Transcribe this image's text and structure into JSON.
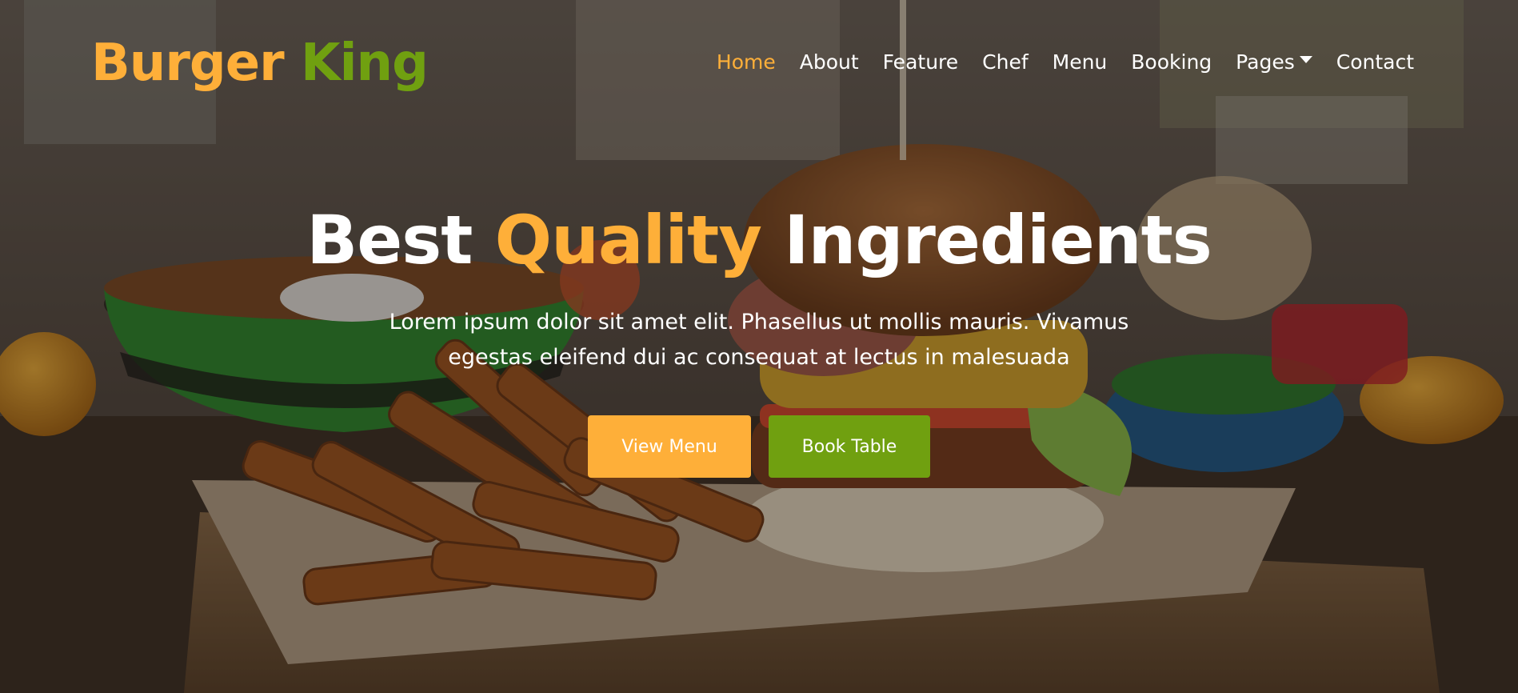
{
  "brand": {
    "word1": "Burger",
    "word2": "King"
  },
  "nav": {
    "items": [
      {
        "label": "Home",
        "active": true
      },
      {
        "label": "About"
      },
      {
        "label": "Feature"
      },
      {
        "label": "Chef"
      },
      {
        "label": "Menu"
      },
      {
        "label": "Booking"
      },
      {
        "label": "Pages",
        "dropdown": true
      },
      {
        "label": "Contact"
      }
    ]
  },
  "hero": {
    "headline_part1": "Best",
    "headline_accent": "Quality",
    "headline_part2": "Ingredients",
    "subtext": "Lorem ipsum dolor sit amet elit. Phasellus ut mollis mauris. Vivamus egestas eleifend dui ac consequat at lectus in malesuada",
    "primary_button": "View Menu",
    "secondary_button": "Book Table"
  },
  "colors": {
    "primary": "#FEAF39",
    "secondary": "#70A010",
    "text": "#FFFFFF"
  },
  "icons": {
    "pages_dropdown": "caret-down-icon",
    "background": "burger-and-fries-photo"
  }
}
